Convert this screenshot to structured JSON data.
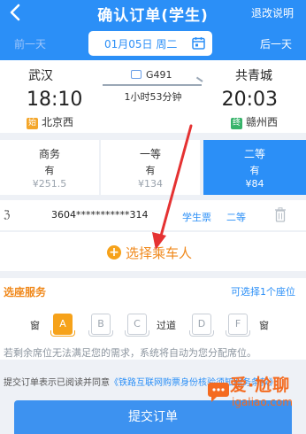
{
  "header": {
    "title": "确认订单(学生)",
    "right_link": "退改说明"
  },
  "datebar": {
    "prev": "前一天",
    "date": "01月05日 周二",
    "next": "后一天"
  },
  "train": {
    "from_city": "武汉",
    "to_city": "共青城",
    "number": "G491",
    "from_time": "18:10",
    "to_time": "20:03",
    "duration": "1小时53分钟",
    "from_station": "北京西",
    "to_station": "赣州西",
    "from_badge": "始",
    "to_badge": "终"
  },
  "seat_classes": [
    {
      "name": "商务",
      "availability": "有",
      "price": "¥251.5"
    },
    {
      "name": "一等",
      "availability": "有",
      "price": "¥134"
    },
    {
      "name": "二等",
      "availability": "有",
      "price": "¥84"
    }
  ],
  "passenger": {
    "name_fragment": "ℨ",
    "id": "3604***********314",
    "type": "学生票",
    "seat": "二等"
  },
  "choose_passenger": "选择乘车人",
  "seat_service": {
    "title": "选座服务",
    "hint": "可选择1个座位",
    "window_label": "窗",
    "aisle_label": "过道",
    "seats": [
      "A",
      "B",
      "C",
      "D",
      "F"
    ],
    "selected": "A",
    "note": "若剩余席位无法满足您的需求，系统将自动为您分配席位。"
  },
  "agreement": {
    "prefix": "提交订单表示已阅读并同意",
    "link": "《铁路互联网购票身份核验须知服务条款》"
  },
  "submit_label": "提交订单",
  "watermark": {
    "line1": "爱·尬聊",
    "line2": "igaliao.com"
  },
  "colors": {
    "primary": "#2b8ff7",
    "accent": "#f6a21a",
    "annotation_arrow": "#e53232"
  }
}
